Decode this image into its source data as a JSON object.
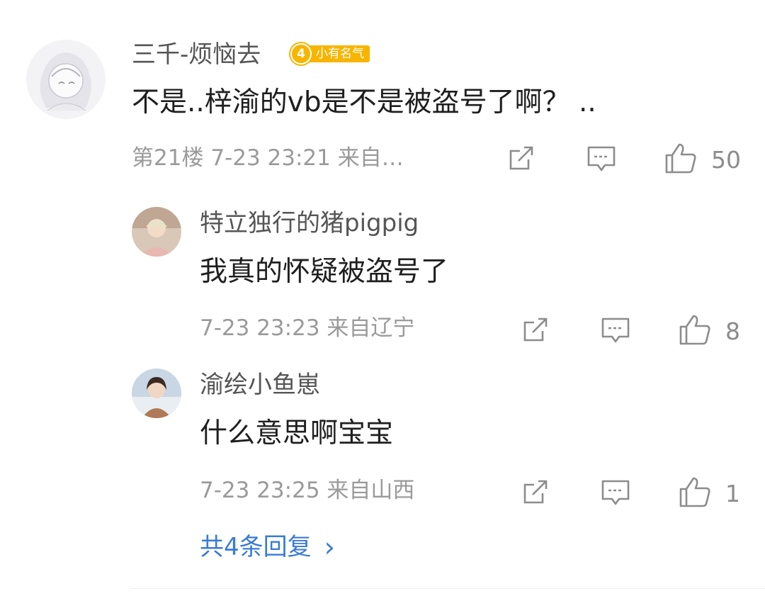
{
  "main_comment": {
    "username": "三千-烦恼去",
    "badge": {
      "level": "4",
      "label": "小有名气",
      "color": "#f7b500"
    },
    "text": "不是..梓渝的vb是不是被盗号了啊？ ..",
    "floor": "第21楼",
    "time": "7-23 23:21",
    "source": "来自…",
    "likes": "50"
  },
  "replies": [
    {
      "username": "特立独行的猪pigpig",
      "text": "我真的怀疑被盗号了",
      "time": "7-23 23:23",
      "source": "来自辽宁",
      "likes": "8"
    },
    {
      "username": "渝绘小鱼崽",
      "text": "什么意思啊宝宝",
      "time": "7-23 23:25",
      "source": "来自山西",
      "likes": "1"
    }
  ],
  "more_replies": {
    "label": "共4条回复",
    "chevron": "›"
  },
  "icons": {
    "share": "share-icon",
    "comment": "comment-icon",
    "like": "thumbs-up-icon"
  },
  "colors": {
    "link": "#3a7bd5",
    "meta": "#9a9a9a",
    "icon": "#8c8c8c"
  }
}
